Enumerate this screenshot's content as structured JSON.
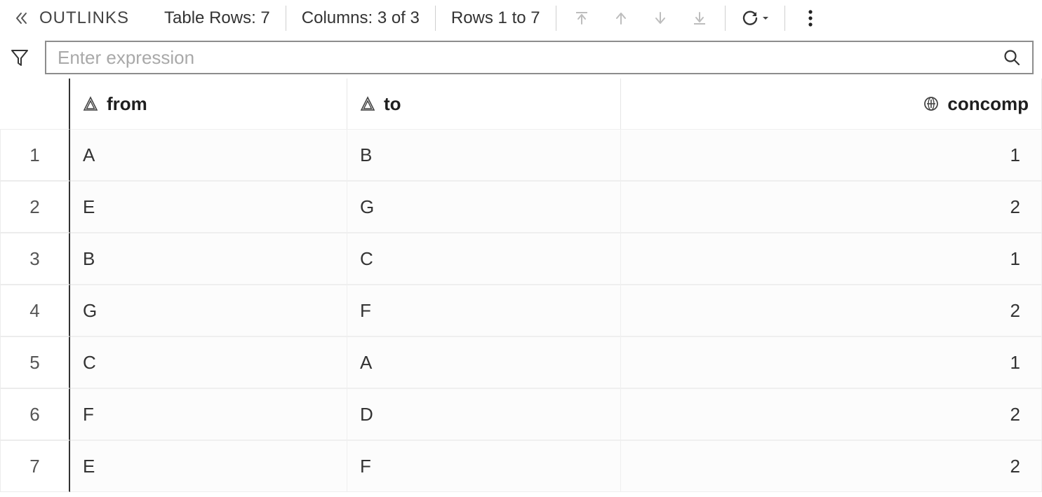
{
  "header": {
    "panel_title": "OUTLINKS",
    "rows_label": "Table Rows: 7",
    "cols_label": "Columns: 3 of 3",
    "range_label": "Rows 1 to 7"
  },
  "filter": {
    "placeholder": "Enter expression",
    "value": ""
  },
  "columns": [
    {
      "key": "from",
      "label": "from",
      "type": "char",
      "align": "left"
    },
    {
      "key": "to",
      "label": "to",
      "type": "char",
      "align": "left"
    },
    {
      "key": "concomp",
      "label": "concomp",
      "type": "number",
      "align": "right"
    }
  ],
  "rows": [
    {
      "n": "1",
      "from": "A",
      "to": "B",
      "concomp": "1"
    },
    {
      "n": "2",
      "from": "E",
      "to": "G",
      "concomp": "2"
    },
    {
      "n": "3",
      "from": "B",
      "to": "C",
      "concomp": "1"
    },
    {
      "n": "4",
      "from": "G",
      "to": "F",
      "concomp": "2"
    },
    {
      "n": "5",
      "from": "C",
      "to": "A",
      "concomp": "1"
    },
    {
      "n": "6",
      "from": "F",
      "to": "D",
      "concomp": "2"
    },
    {
      "n": "7",
      "from": "E",
      "to": "F",
      "concomp": "2"
    }
  ]
}
